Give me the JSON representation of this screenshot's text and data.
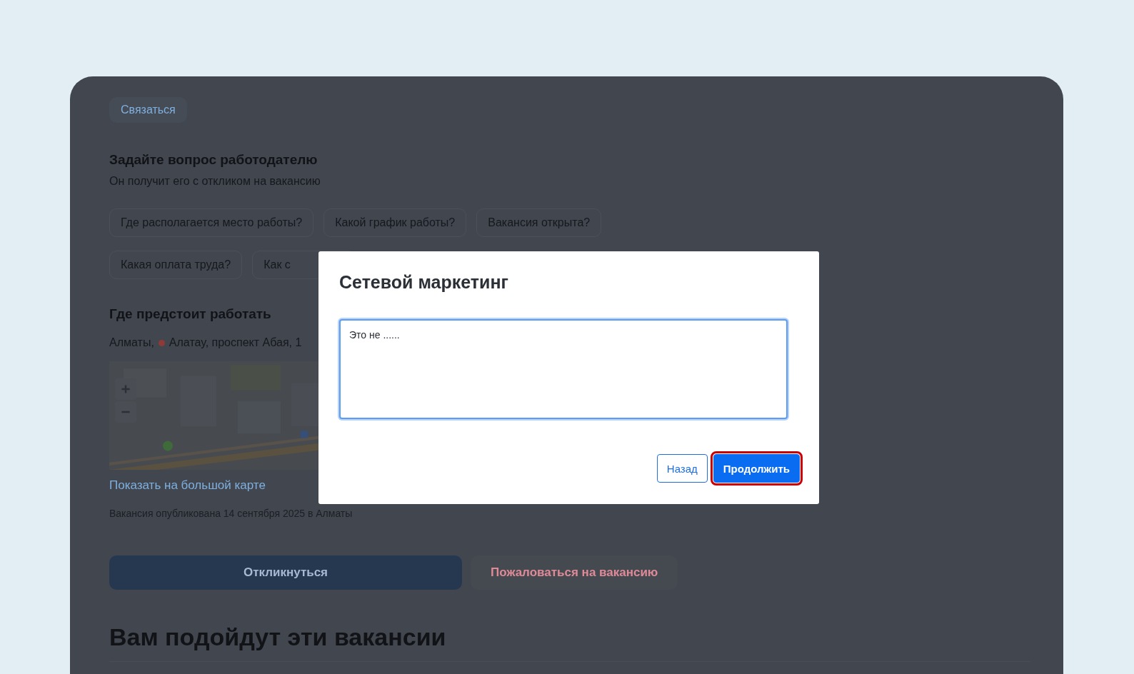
{
  "page": {
    "contact_button": "Связаться",
    "question_section": {
      "title": "Задайте вопрос работодателю",
      "subtitle": "Он получит его с откликом на вакансию",
      "chips": [
        "Где располагается место работы?",
        "Какой график работы?",
        "Вакансия открыта?",
        "Какая оплата труда?",
        "Как с"
      ]
    },
    "location_section": {
      "title": "Где предстоит работать",
      "city": "Алматы,",
      "address": "Алатау, проспект Абая, 1",
      "map_link": "Показать на большой карте"
    },
    "published": "Вакансия опубликована 14 сентября 2025 в Алматы",
    "respond_button": "Откликнуться",
    "complain_button": "Пожаловаться на вакансию",
    "recommendations_title": "Вам подойдут эти вакансии"
  },
  "dialog": {
    "title": "Сетевой маркетинг",
    "textarea": {
      "value": "Это не ......",
      "focused": true
    },
    "buttons": [
      {
        "label": "Назад",
        "kind": "secondary",
        "highlighted": false
      },
      {
        "label": "Продолжить",
        "kind": "primary",
        "highlighted": true
      }
    ]
  }
}
